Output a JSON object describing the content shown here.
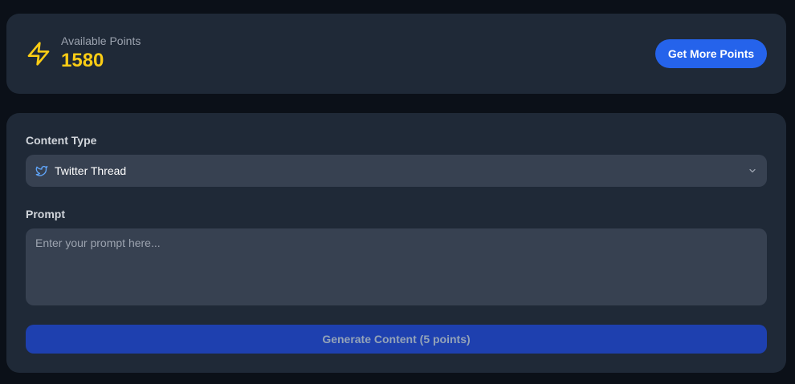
{
  "points": {
    "label": "Available Points",
    "value": "1580",
    "icon": "lightning-bolt-icon",
    "get_more_label": "Get More Points"
  },
  "form": {
    "content_type_label": "Content Type",
    "content_type_selected": "Twitter Thread",
    "content_type_icon": "twitter-icon",
    "prompt_label": "Prompt",
    "prompt_placeholder": "Enter your prompt here...",
    "prompt_value": "",
    "generate_label": "Generate Content (5 points)"
  },
  "colors": {
    "background": "#0b1018",
    "card": "#1f2937",
    "input": "#374151",
    "points_accent": "#facc15",
    "primary_button": "#2563eb",
    "disabled_button": "#1e40af",
    "twitter_blue": "#60a5fa"
  }
}
